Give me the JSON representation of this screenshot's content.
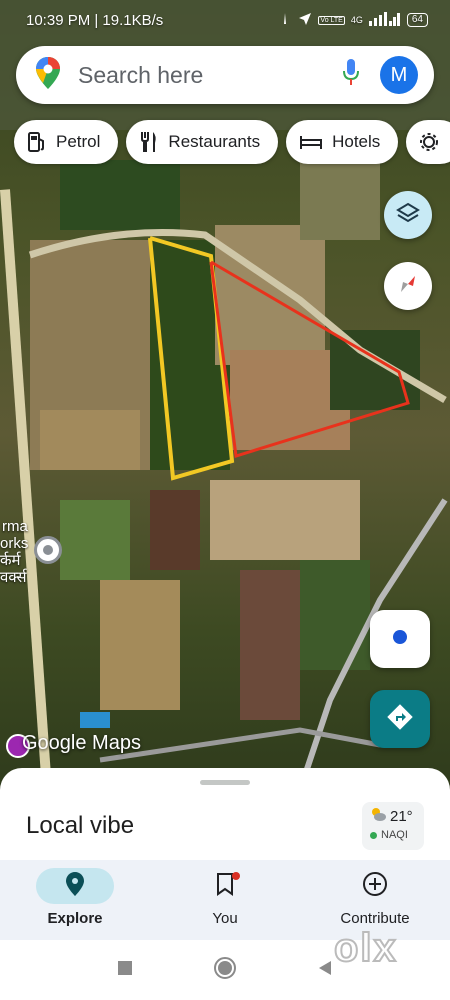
{
  "status_bar": {
    "time_speed": "10:39 PM | 19.1KB/s",
    "network": "4G",
    "volte": "Vo LTE",
    "battery": "64"
  },
  "search": {
    "placeholder": "Search here",
    "avatar_letter": "M"
  },
  "chips": [
    {
      "label": "Petrol",
      "icon": "fuel-pump-icon"
    },
    {
      "label": "Restaurants",
      "icon": "fork-knife-icon"
    },
    {
      "label": "Hotels",
      "icon": "bed-icon"
    }
  ],
  "map": {
    "place_label_lines": [
      "rma",
      "orks",
      "र्कर्म",
      "वर्क्स"
    ],
    "attribution": "Google Maps",
    "annotation_colors": {
      "yellow_outline": "#f2c824",
      "red_outline": "#e8321c"
    }
  },
  "sheet": {
    "title": "Local vibe",
    "weather": {
      "temperature": "21°",
      "aqi": "NAQI"
    }
  },
  "nav": {
    "explore": "Explore",
    "you": "You",
    "contribute": "Contribute"
  },
  "watermark": "olx",
  "colors": {
    "accent": "#1a73e8",
    "directions": "#0b7c86",
    "layers_bg": "#c8eaf5",
    "nav_bg": "#eef2f8",
    "active_pill": "#c5e6ef"
  }
}
